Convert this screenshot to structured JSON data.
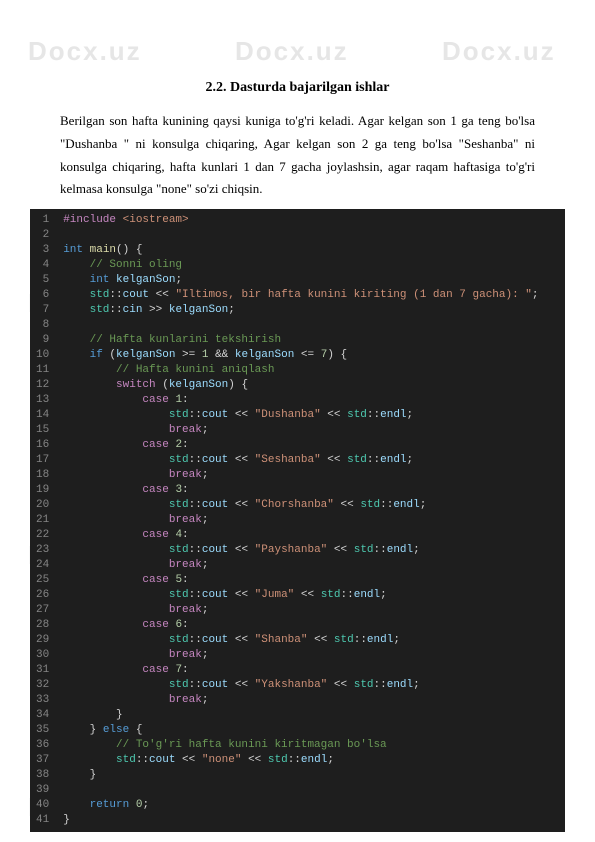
{
  "watermark": "Docx.uz",
  "section_title": "2.2.  Dasturda  bajarilgan ishlar",
  "paragraph": "Berilgan son hafta kunining qaysi kuniga to'g'ri keladi. Agar kelgan son 1 ga teng bo'lsa \"Dushanba \" ni konsulga chiqaring, Agar kelgan son 2 ga teng bo'lsa \"Seshanba\" ni konsulga chiqaring, hafta kunlari 1 dan 7 gacha joylashsin, agar raqam haftasiga to'g'ri kelmasa konsulga \"none\" so'zi chiqsin.",
  "code": {
    "line_count": 41,
    "lines": [
      {
        "n": 1,
        "html": "<span class='tok-include'>#include</span> <span class='tok-header'>&lt;iostream&gt;</span>"
      },
      {
        "n": 2,
        "html": ""
      },
      {
        "n": 3,
        "html": "<span class='tok-type'>int</span> <span class='tok-fn'>main</span>() {"
      },
      {
        "n": 4,
        "html": "    <span class='tok-comment'>// Sonni oling</span>"
      },
      {
        "n": 5,
        "html": "    <span class='tok-type'>int</span> <span class='tok-id'>kelganSon</span>;"
      },
      {
        "n": 6,
        "html": "    <span class='tok-ns'>std</span>::<span class='tok-id'>cout</span> <span class='tok-op'>&lt;&lt;</span> <span class='tok-str'>\"Iltimos, bir hafta kunini kiriting (1 dan 7 gacha): \"</span>;"
      },
      {
        "n": 7,
        "html": "    <span class='tok-ns'>std</span>::<span class='tok-id'>cin</span> <span class='tok-op'>&gt;&gt;</span> <span class='tok-id'>kelganSon</span>;"
      },
      {
        "n": 8,
        "html": ""
      },
      {
        "n": 9,
        "html": "    <span class='tok-comment'>// Hafta kunlarini tekshirish</span>"
      },
      {
        "n": 10,
        "html": "    <span class='tok-kw'>if</span> (<span class='tok-id'>kelganSon</span> <span class='tok-op'>&gt;=</span> <span class='tok-num'>1</span> <span class='tok-op'>&amp;&amp;</span> <span class='tok-id'>kelganSon</span> <span class='tok-op'>&lt;=</span> <span class='tok-num'>7</span>) {"
      },
      {
        "n": 11,
        "html": "        <span class='tok-comment'>// Hafta kunini aniqlash</span>"
      },
      {
        "n": 12,
        "html": "        <span class='tok-case'>switch</span> (<span class='tok-id'>kelganSon</span>) {"
      },
      {
        "n": 13,
        "html": "            <span class='tok-case'>case</span> <span class='tok-num'>1</span>:"
      },
      {
        "n": 14,
        "html": "                <span class='tok-ns'>std</span>::<span class='tok-id'>cout</span> <span class='tok-op'>&lt;&lt;</span> <span class='tok-str'>\"Dushanba\"</span> <span class='tok-op'>&lt;&lt;</span> <span class='tok-ns'>std</span>::<span class='tok-id'>endl</span>;"
      },
      {
        "n": 15,
        "html": "                <span class='tok-break'>break</span>;"
      },
      {
        "n": 16,
        "html": "            <span class='tok-case'>case</span> <span class='tok-num'>2</span>:"
      },
      {
        "n": 17,
        "html": "                <span class='tok-ns'>std</span>::<span class='tok-id'>cout</span> <span class='tok-op'>&lt;&lt;</span> <span class='tok-str'>\"Seshanba\"</span> <span class='tok-op'>&lt;&lt;</span> <span class='tok-ns'>std</span>::<span class='tok-id'>endl</span>;"
      },
      {
        "n": 18,
        "html": "                <span class='tok-break'>break</span>;"
      },
      {
        "n": 19,
        "html": "            <span class='tok-case'>case</span> <span class='tok-num'>3</span>:"
      },
      {
        "n": 20,
        "html": "                <span class='tok-ns'>std</span>::<span class='tok-id'>cout</span> <span class='tok-op'>&lt;&lt;</span> <span class='tok-str'>\"Chorshanba\"</span> <span class='tok-op'>&lt;&lt;</span> <span class='tok-ns'>std</span>::<span class='tok-id'>endl</span>;"
      },
      {
        "n": 21,
        "html": "                <span class='tok-break'>break</span>;"
      },
      {
        "n": 22,
        "html": "            <span class='tok-case'>case</span> <span class='tok-num'>4</span>:"
      },
      {
        "n": 23,
        "html": "                <span class='tok-ns'>std</span>::<span class='tok-id'>cout</span> <span class='tok-op'>&lt;&lt;</span> <span class='tok-str'>\"Payshanba\"</span> <span class='tok-op'>&lt;&lt;</span> <span class='tok-ns'>std</span>::<span class='tok-id'>endl</span>;"
      },
      {
        "n": 24,
        "html": "                <span class='tok-break'>break</span>;"
      },
      {
        "n": 25,
        "html": "            <span class='tok-case'>case</span> <span class='tok-num'>5</span>:"
      },
      {
        "n": 26,
        "html": "                <span class='tok-ns'>std</span>::<span class='tok-id'>cout</span> <span class='tok-op'>&lt;&lt;</span> <span class='tok-str'>\"Juma\"</span> <span class='tok-op'>&lt;&lt;</span> <span class='tok-ns'>std</span>::<span class='tok-id'>endl</span>;"
      },
      {
        "n": 27,
        "html": "                <span class='tok-break'>break</span>;"
      },
      {
        "n": 28,
        "html": "            <span class='tok-case'>case</span> <span class='tok-num'>6</span>:"
      },
      {
        "n": 29,
        "html": "                <span class='tok-ns'>std</span>::<span class='tok-id'>cout</span> <span class='tok-op'>&lt;&lt;</span> <span class='tok-str'>\"Shanba\"</span> <span class='tok-op'>&lt;&lt;</span> <span class='tok-ns'>std</span>::<span class='tok-id'>endl</span>;"
      },
      {
        "n": 30,
        "html": "                <span class='tok-break'>break</span>;"
      },
      {
        "n": 31,
        "html": "            <span class='tok-case'>case</span> <span class='tok-num'>7</span>:"
      },
      {
        "n": 32,
        "html": "                <span class='tok-ns'>std</span>::<span class='tok-id'>cout</span> <span class='tok-op'>&lt;&lt;</span> <span class='tok-str'>\"Yakshanba\"</span> <span class='tok-op'>&lt;&lt;</span> <span class='tok-ns'>std</span>::<span class='tok-id'>endl</span>;"
      },
      {
        "n": 33,
        "html": "                <span class='tok-break'>break</span>;"
      },
      {
        "n": 34,
        "html": "        }"
      },
      {
        "n": 35,
        "html": "    } <span class='tok-kw'>else</span> {"
      },
      {
        "n": 36,
        "html": "        <span class='tok-comment'>// To'g'ri hafta kunini kiritmagan bo'lsa</span>"
      },
      {
        "n": 37,
        "html": "        <span class='tok-ns'>std</span>::<span class='tok-id'>cout</span> <span class='tok-op'>&lt;&lt;</span> <span class='tok-str'>\"none\"</span> <span class='tok-op'>&lt;&lt;</span> <span class='tok-ns'>std</span>::<span class='tok-id'>endl</span>;"
      },
      {
        "n": 38,
        "html": "    }"
      },
      {
        "n": 39,
        "html": ""
      },
      {
        "n": 40,
        "html": "    <span class='tok-kw'>return</span> <span class='tok-num'>0</span>;"
      },
      {
        "n": 41,
        "html": "}"
      }
    ]
  }
}
